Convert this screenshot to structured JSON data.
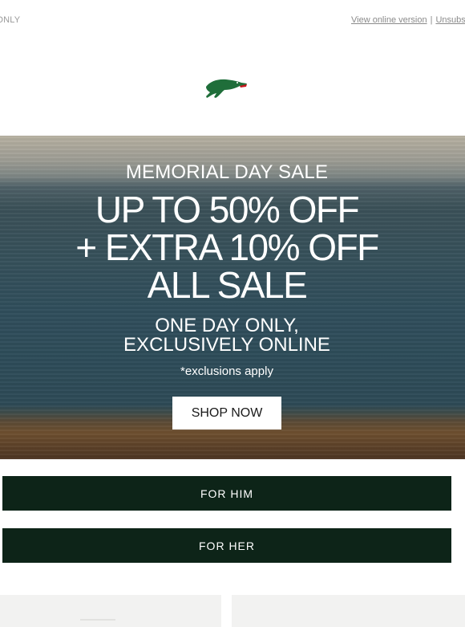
{
  "preheader": {
    "left_text": "AY ONLY",
    "view_online": "View online version",
    "separator": "|",
    "unsubscribe": "Unsubsc"
  },
  "logo": {
    "icon": "crocodile-logo-icon",
    "color": "#1f6e3a"
  },
  "hero": {
    "sale_title": "MEMORIAL DAY SALE",
    "headline_lines": [
      "UP TO 50% OFF",
      "+ EXTRA 10% OFF",
      "ALL SALE"
    ],
    "subline_lines": [
      "ONE DAY ONLY,",
      "EXCLUSIVELY ONLINE"
    ],
    "exclusions": "*exclusions apply",
    "cta": "SHOP NOW"
  },
  "categories": [
    {
      "label": "FOR HIM"
    },
    {
      "label": "FOR HER"
    }
  ],
  "colors": {
    "category_button_bg": "#0d2418",
    "cta_bg": "#ffffff",
    "card_bg": "#f2f2f1"
  }
}
